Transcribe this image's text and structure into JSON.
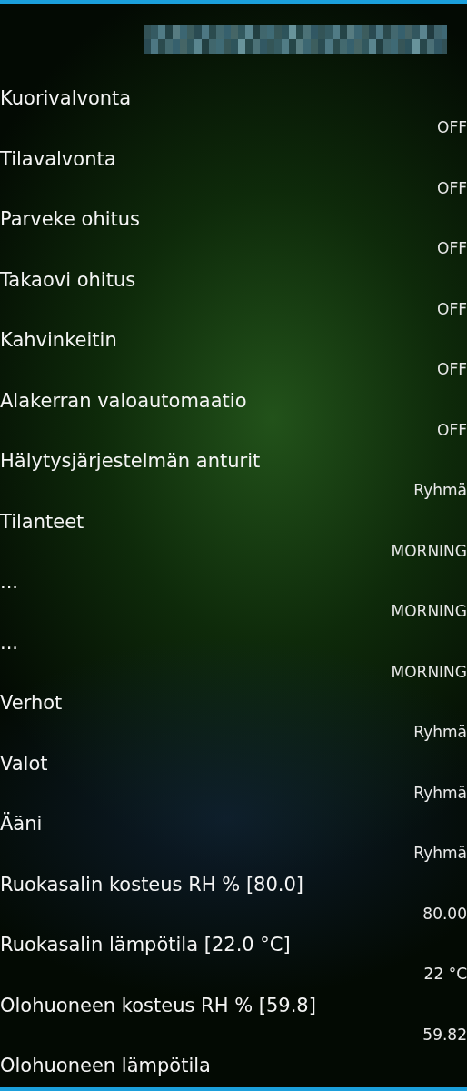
{
  "items": [
    {
      "label": "Kuorivalvonta",
      "value": "OFF"
    },
    {
      "label": "Tilavalvonta",
      "value": "OFF"
    },
    {
      "label": "Parveke ohitus",
      "value": "OFF"
    },
    {
      "label": "Takaovi ohitus",
      "value": "OFF"
    },
    {
      "label": "Kahvinkeitin",
      "value": "OFF"
    },
    {
      "label": "Alakerran valoautomaatio",
      "value": "OFF"
    },
    {
      "label": "Hälytysjärjestelmän anturit",
      "value": "Ryhmä"
    },
    {
      "label": "Tilanteet",
      "value": "MORNING"
    },
    {
      "label": "...",
      "value": "MORNING"
    },
    {
      "label": "...",
      "value": "MORNING"
    },
    {
      "label": "Verhot",
      "value": "Ryhmä"
    },
    {
      "label": "Valot",
      "value": "Ryhmä"
    },
    {
      "label": "Ääni",
      "value": "Ryhmä"
    },
    {
      "label": "Ruokasalin kosteus RH % [80.0]",
      "value": "80.00"
    },
    {
      "label": "Ruokasalin lämpötila [22.0 °C]",
      "value": "22 °C"
    },
    {
      "label": "Olohuoneen kosteus RH % [59.8]",
      "value": "59.82"
    },
    {
      "label": "Olohuoneen lämpötila"
    }
  ]
}
